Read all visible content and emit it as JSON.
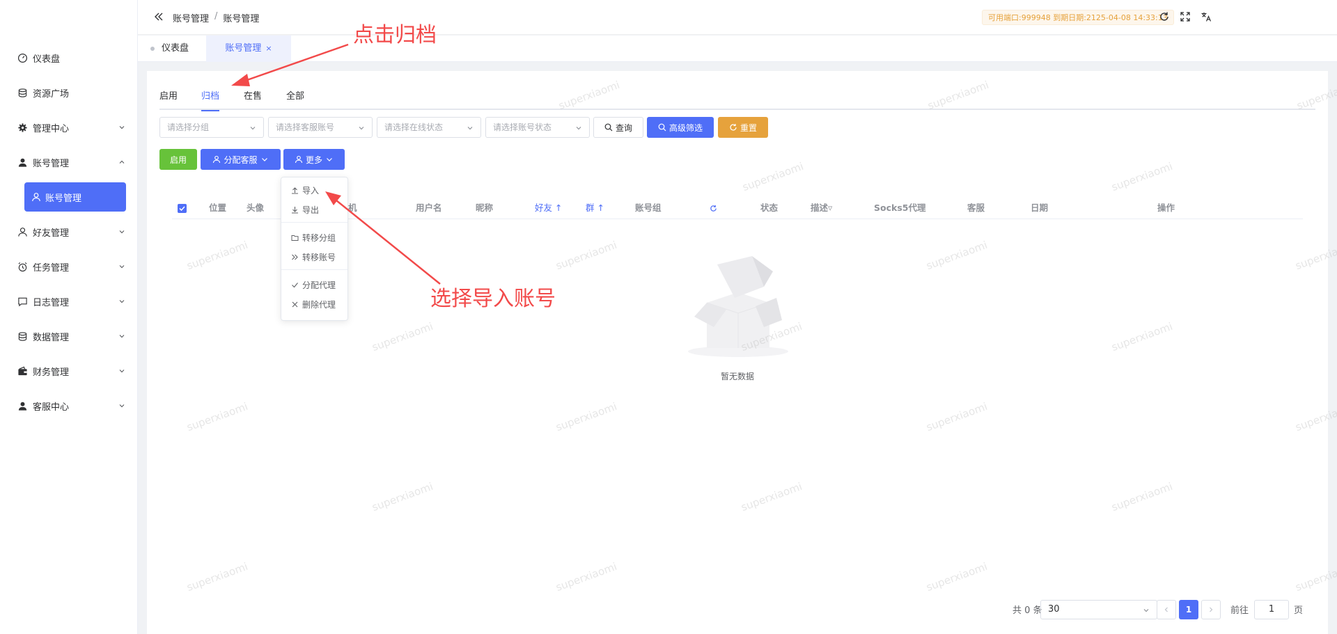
{
  "sidebar": {
    "items": [
      {
        "label": "仪表盘",
        "icon": "dashboard-icon"
      },
      {
        "label": "资源广场",
        "icon": "database-icon"
      },
      {
        "label": "管理中心",
        "icon": "gear-icon"
      },
      {
        "label": "账号管理",
        "icon": "user-icon"
      },
      {
        "label": "好友管理",
        "icon": "user-outline-icon"
      },
      {
        "label": "任务管理",
        "icon": "alarm-clock-icon"
      },
      {
        "label": "日志管理",
        "icon": "chat-bubble-icon"
      },
      {
        "label": "数据管理",
        "icon": "database-icon"
      },
      {
        "label": "财务管理",
        "icon": "wallet-icon"
      },
      {
        "label": "客服中心",
        "icon": "user-icon"
      }
    ],
    "active_sub": {
      "label": "账号管理",
      "icon": "user-outline-icon"
    }
  },
  "header": {
    "breadcrumb": [
      "账号管理",
      "账号管理"
    ],
    "breadcrumb_sep": "/",
    "expire_badge": "可用端口:999948 到期日期:2125-04-08 14:33:13"
  },
  "tabs": [
    {
      "label": "仪表盘"
    },
    {
      "label": "账号管理",
      "close": "×"
    }
  ],
  "subtabs": [
    "启用",
    "归档",
    "在售",
    "全部"
  ],
  "filters": {
    "group_placeholder": "请选择分组",
    "cs_account_placeholder": "请选择客服账号",
    "online_status_placeholder": "请选择在线状态",
    "account_status_placeholder": "请选择账号状态",
    "query_label": "查询",
    "advanced_label": "高级筛选",
    "reset_label": "重置"
  },
  "actions": {
    "enable_label": "启用",
    "assign_cs_label": "分配客服",
    "more_label": "更多"
  },
  "dropdown": {
    "items": [
      "导入",
      "导出",
      "转移分组",
      "转移账号",
      "分配代理",
      "删除代理"
    ]
  },
  "table": {
    "columns": [
      "位置",
      "头像",
      "机",
      "用户名",
      "昵称",
      "好友",
      "群",
      "账号组",
      "状态",
      "描述",
      "Socks5代理",
      "客服",
      "日期",
      "操作"
    ],
    "empty_text": "暂无数据"
  },
  "pagination": {
    "total_text": "共 0 条",
    "page_size": "30",
    "current_page": "1",
    "goto_label": "前往",
    "goto_value": "1",
    "page_unit": "页"
  },
  "watermark": "superxiaomi",
  "annotations": {
    "click_archive": "点击归档",
    "select_import": "选择导入账号",
    "color": "#f24a4a"
  },
  "colors": {
    "primary": "#4f6ef7",
    "success": "#67c23a",
    "warning": "#e6a23c"
  }
}
